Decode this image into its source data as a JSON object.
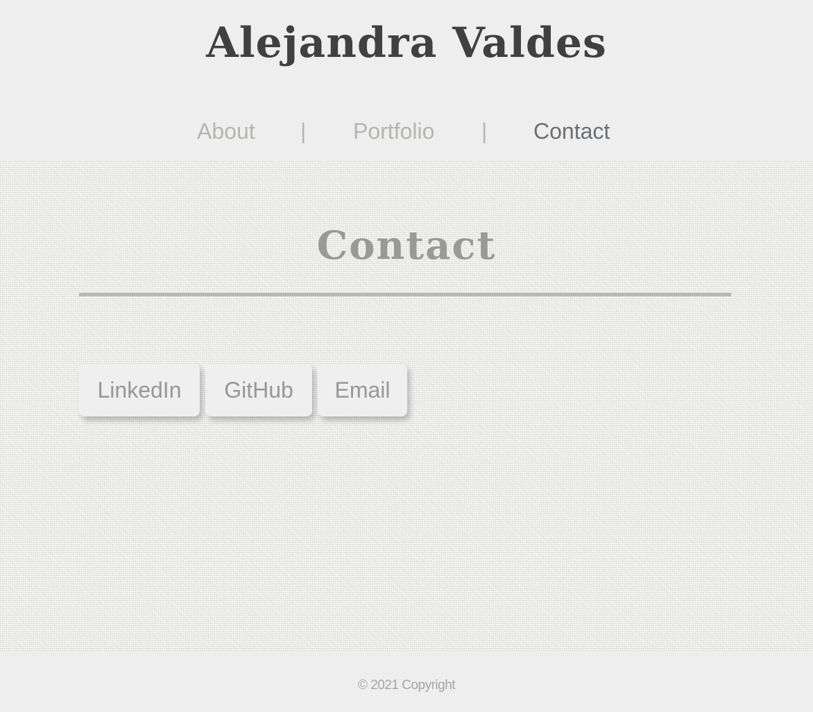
{
  "header": {
    "title": "Alejandra Valdes",
    "nav": {
      "items": [
        {
          "label": "About",
          "active": false
        },
        {
          "label": "Portfolio",
          "active": false
        },
        {
          "label": "Contact",
          "active": true
        }
      ],
      "separator": "|"
    }
  },
  "main": {
    "section_title": "Contact",
    "buttons": [
      {
        "label": "LinkedIn"
      },
      {
        "label": "GitHub"
      },
      {
        "label": "Email"
      }
    ]
  },
  "footer": {
    "copyright": "© 2021 Copyright"
  },
  "colors": {
    "background": "#eeeeee",
    "title": "#404040",
    "nav_inactive": "#b5b5ad",
    "nav_active": "#6b7074",
    "section_title": "#9a9a94",
    "divider": "#b8b8b0",
    "button_bg": "#efefef",
    "button_text": "#979797",
    "footer_text": "#a5a5a5"
  }
}
